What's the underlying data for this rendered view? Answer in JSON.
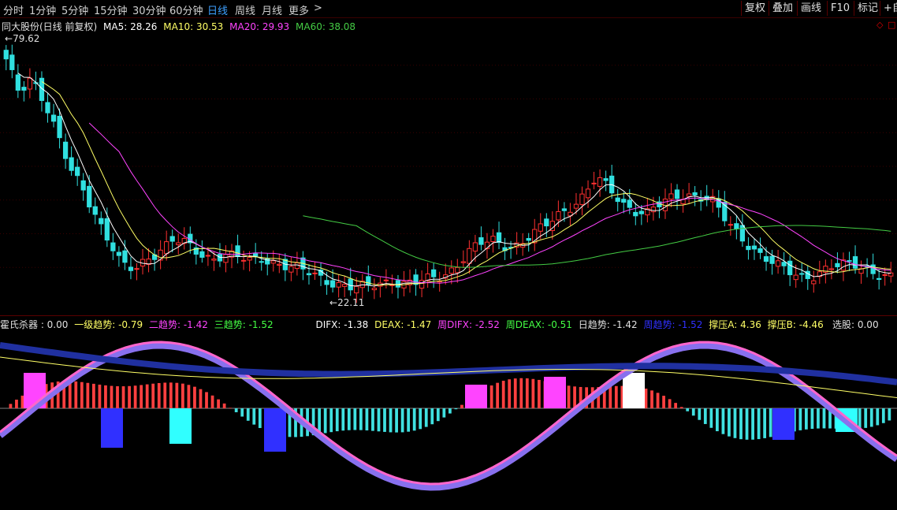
{
  "toolbar": {
    "tabs": [
      "分时",
      "1分钟",
      "5分钟",
      "15分钟",
      "30分钟",
      "60分钟",
      "日线",
      "周线",
      "月线",
      "更多"
    ],
    "more_arrow": ">",
    "active_tab": "日线",
    "right_buttons": [
      "复权",
      "叠加",
      "画线",
      "F10",
      "标记",
      "+自"
    ]
  },
  "main_legend": {
    "name": "同大股份(日线 前复权)",
    "ma5": {
      "label": "MA5: 28.26",
      "color": "#ffffff"
    },
    "ma10": {
      "label": "MA10: 30.53",
      "color": "#ffff66"
    },
    "ma20": {
      "label": "MA20: 29.93",
      "color": "#ff44ff"
    },
    "ma60": {
      "label": "MA60: 38.08",
      "color": "#44cc44"
    }
  },
  "price_marks": {
    "high": "79.62",
    "low": "22.11"
  },
  "indicator_legend": {
    "title": "霍氏杀器 : 0.00",
    "items": [
      {
        "text": "一级趋势: -0.79",
        "color": "#ffff66"
      },
      {
        "text": "二趋势: -1.42",
        "color": "#ff44ff"
      },
      {
        "text": "三趋势: -1.52",
        "color": "#44ff44"
      },
      {
        "text": "DIFX: -1.38",
        "color": "#ffffff"
      },
      {
        "text": "DEAX: -1.47",
        "color": "#ffff66"
      },
      {
        "text": "周DIFX: -2.52",
        "color": "#ff44ff"
      },
      {
        "text": "周DEAX: -0.51",
        "color": "#44ff44"
      },
      {
        "text": "日趋势: -1.42",
        "color": "#e0e0e0"
      },
      {
        "text": "周趋势: -1.52",
        "color": "#3030ff"
      },
      {
        "text": "撑压A: 4.36",
        "color": "#ffff66"
      },
      {
        "text": "撑压B: -4.46",
        "color": "#ffff66"
      }
    ],
    "select": "选股: 0.00"
  },
  "chart_data": {
    "type": "candlestick",
    "closes": [
      75,
      68,
      72,
      66,
      58,
      50,
      46,
      40,
      34,
      28,
      27,
      30,
      32,
      34,
      33,
      31,
      30,
      31,
      30,
      29,
      30,
      29,
      28,
      27,
      26,
      25,
      24,
      23,
      23,
      24,
      25,
      24,
      24,
      25,
      26,
      28,
      31,
      33,
      34,
      33,
      33,
      35,
      37,
      40,
      42,
      44,
      48,
      46,
      43,
      41,
      40,
      42,
      44,
      45,
      44,
      43,
      39,
      36,
      33,
      30,
      28,
      27,
      26,
      26,
      27,
      28,
      29,
      28,
      26,
      25
    ],
    "ma60_color": "#44cc44",
    "ylim": [
      20,
      82
    ],
    "up_color": "#ff3030",
    "down_color": "#30e0e0"
  },
  "colors": {
    "bg": "#000000",
    "grid": "#5a0000",
    "active": "#3ea0ff"
  }
}
